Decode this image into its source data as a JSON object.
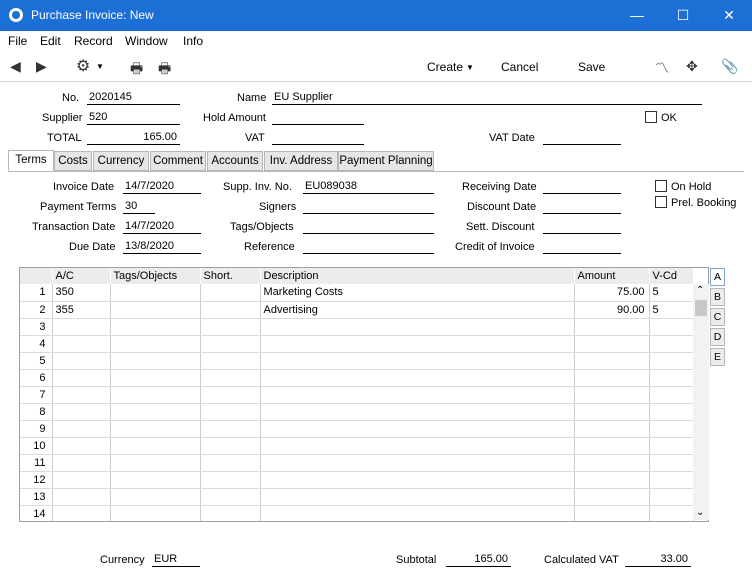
{
  "window": {
    "title": "Purchase Invoice: New",
    "minimize": "—",
    "maximize": "☐",
    "close": "✕"
  },
  "menu": [
    "File",
    "Edit",
    "Record",
    "Window",
    "Info"
  ],
  "toolbar": {
    "create": "Create",
    "cancel": "Cancel",
    "save": "Save"
  },
  "header": {
    "no_label": "No.",
    "no_value": "2020145",
    "name_label": "Name",
    "name_value": "EU Supplier",
    "supplier_label": "Supplier",
    "supplier_value": "520",
    "hold_label": "Hold Amount",
    "hold_value": "",
    "ok_label": "OK",
    "total_label": "TOTAL",
    "total_value": "165.00",
    "vat_label": "VAT",
    "vat_value": "",
    "vatdate_label": "VAT Date",
    "vatdate_value": ""
  },
  "tabs": [
    "Terms",
    "Costs",
    "Currency",
    "Comment",
    "Accounts",
    "Inv. Address",
    "Payment Planning"
  ],
  "terms": {
    "invoice_date_label": "Invoice Date",
    "invoice_date": "14/7/2020",
    "payment_terms_label": "Payment Terms",
    "payment_terms": "30",
    "transaction_date_label": "Transaction Date",
    "transaction_date": "14/7/2020",
    "due_date_label": "Due Date",
    "due_date": "13/8/2020",
    "supp_inv_label": "Supp. Inv. No.",
    "supp_inv": "EU089038",
    "signers_label": "Signers",
    "signers": "",
    "tags_label": "Tags/Objects",
    "tags": "",
    "reference_label": "Reference",
    "reference": "",
    "receiving_date_label": "Receiving Date",
    "receiving_date": "",
    "discount_date_label": "Discount Date",
    "discount_date": "",
    "sett_discount_label": "Sett. Discount",
    "sett_discount": "",
    "credit_of_invoice_label": "Credit of Invoice",
    "credit_of_invoice": "",
    "on_hold_label": "On Hold",
    "prel_booking_label": "Prel. Booking"
  },
  "grid": {
    "columns": [
      "",
      "A/C",
      "Tags/Objects",
      "Short.",
      "Description",
      "Amount",
      "V-Cd"
    ],
    "rows": [
      [
        "1",
        "350",
        "",
        "",
        "Marketing Costs",
        "75.00",
        "5"
      ],
      [
        "2",
        "355",
        "",
        "",
        "Advertising",
        "90.00",
        "5"
      ],
      [
        "3",
        "",
        "",
        "",
        "",
        "",
        ""
      ],
      [
        "4",
        "",
        "",
        "",
        "",
        "",
        ""
      ],
      [
        "5",
        "",
        "",
        "",
        "",
        "",
        ""
      ],
      [
        "6",
        "",
        "",
        "",
        "",
        "",
        ""
      ],
      [
        "7",
        "",
        "",
        "",
        "",
        "",
        ""
      ],
      [
        "8",
        "",
        "",
        "",
        "",
        "",
        ""
      ],
      [
        "9",
        "",
        "",
        "",
        "",
        "",
        ""
      ],
      [
        "10",
        "",
        "",
        "",
        "",
        "",
        ""
      ],
      [
        "11",
        "",
        "",
        "",
        "",
        "",
        ""
      ],
      [
        "12",
        "",
        "",
        "",
        "",
        "",
        ""
      ],
      [
        "13",
        "",
        "",
        "",
        "",
        "",
        ""
      ],
      [
        "14",
        "",
        "",
        "",
        "",
        "",
        ""
      ]
    ],
    "side_tabs": [
      "A",
      "B",
      "C",
      "D",
      "E"
    ]
  },
  "footer": {
    "currency_label": "Currency",
    "currency_value": "EUR",
    "subtotal_label": "Subtotal",
    "subtotal_value": "165.00",
    "calc_vat_label": "Calculated VAT",
    "calc_vat_value": "33.00"
  }
}
